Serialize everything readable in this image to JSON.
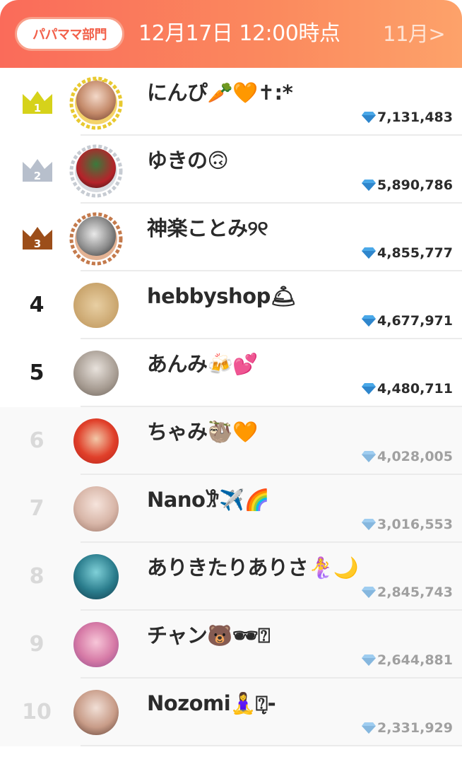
{
  "header": {
    "category": "パパママ部門",
    "timestamp": "12月17日 12:00時点",
    "month_link": "11月>"
  },
  "rows": [
    {
      "rank": "1",
      "name": "にんぴ🥕🧡✝︎:*",
      "score": "7,131,483"
    },
    {
      "rank": "2",
      "name": "ゆきの🙃",
      "score": "5,890,786"
    },
    {
      "rank": "3",
      "name": "神楽ことみ୨୧",
      "score": "4,855,777"
    },
    {
      "rank": "4",
      "name": "hebbyshop🛎",
      "score": "4,677,971"
    },
    {
      "rank": "5",
      "name": "あんみ🍻💕",
      "score": "4,480,711"
    },
    {
      "rank": "6",
      "name": "ちゃみ🦥🧡",
      "score": "4,028,005"
    },
    {
      "rank": "7",
      "name": "Nano𐦂✈️🌈",
      "score": "3,016,553"
    },
    {
      "rank": "8",
      "name": "ありきたりありさ🧜‍♀️🌙",
      "score": "2,845,743"
    },
    {
      "rank": "9",
      "name": "チャン🐻🕶⍰",
      "score": "2,644,881"
    },
    {
      "rank": "10",
      "name": "Nozomi🧘‍♀️⍰̨-",
      "score": "2,331,929"
    }
  ],
  "colors": {
    "gold": "#d6d21a",
    "silver": "#b7bfcc",
    "bronze": "#9c4e1a",
    "header_start": "#fa6b5a",
    "header_end": "#fda26a",
    "gem": "#4aa8e8"
  },
  "icons": {
    "crown": "crown-icon",
    "gem": "diamond-gem-icon"
  }
}
